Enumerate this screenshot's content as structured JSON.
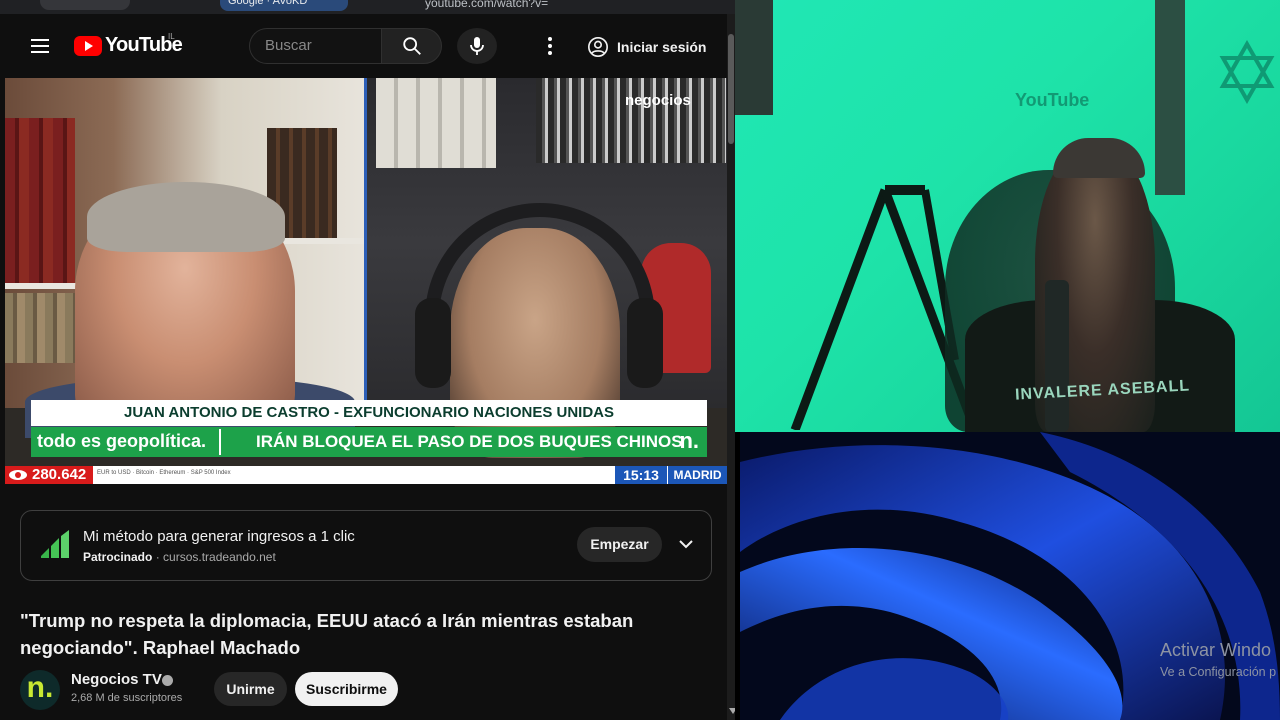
{
  "browser": {
    "url": "youtube.com/watch?v=",
    "tab_label": "Google · AVoKD"
  },
  "header": {
    "logo_text": "YouTube",
    "country_code": "IL",
    "search_placeholder": "Buscar",
    "signin_label": "Iniciar sesión"
  },
  "video": {
    "watermark": "negocios",
    "lower_third_name": "JUAN ANTONIO DE CASTRO - EXFUNCIONARIO NACIONES UNIDAS",
    "program_tag": "todo es geopolítica.",
    "headline": "IRÁN BLOQUEA EL PASO DE DOS BUQUES CHINOS",
    "brand_mark": "n.",
    "viewers": "280.642",
    "ticker_items": "EUR to USD   ·   Bitcoin   ·   Ethereum   ·   S&P 500 Index",
    "clock": "15:13",
    "city": "MADRID"
  },
  "ad": {
    "title": "Mi método para generar ingresos a 1 clic",
    "sponsored_label": "Patrocinado",
    "domain": "cursos.tradeando.net",
    "cta_label": "Empezar"
  },
  "watch": {
    "title": "\"Trump no respeta la diplomacia, EEUU atacó a Irán mientras estaban negociando\". Raphael Machado",
    "channel_name": "Negocios TV",
    "channel_avatar_letter": "n.",
    "subscribers": "2,68 M de suscriptores",
    "join_label": "Unirme",
    "subscribe_label": "Suscribirme"
  },
  "webcam": {
    "background_mark": "YouTube",
    "shirt_text": "INVALERE ASEBALL"
  },
  "desktop": {
    "activate_title": "Activar Windo",
    "activate_sub": "Ve a Configuración p"
  },
  "colors": {
    "youtube_red": "#ff0000",
    "news_green": "#1da24a",
    "news_blue": "#1c57b8",
    "webcam_tint": "#1ee3a9"
  }
}
